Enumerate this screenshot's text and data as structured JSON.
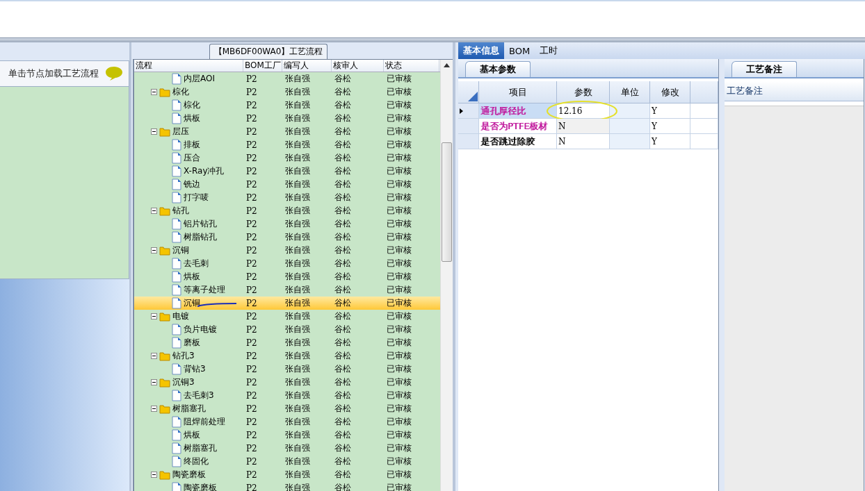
{
  "left_panel": {
    "hint": "单击节点加载工艺流程"
  },
  "flow_panel": {
    "title": "【MB6DF00WA0】工艺流程",
    "columns": [
      "流程",
      "BOM工厂",
      "编写人",
      "核审人",
      "状态"
    ],
    "items": [
      {
        "kind": "leaf",
        "label": "内层AOI",
        "bom": "P2",
        "author": "张自强",
        "reviewer": "谷松",
        "status": "已审核",
        "selected": false
      },
      {
        "kind": "group",
        "label": "棕化",
        "bom": "P2",
        "author": "张自强",
        "reviewer": "谷松",
        "status": "已审核",
        "selected": false,
        "expanded": true,
        "children": [
          {
            "kind": "leaf",
            "label": "棕化",
            "bom": "P2",
            "author": "张自强",
            "reviewer": "谷松",
            "status": "已审核",
            "selected": false
          },
          {
            "kind": "leaf",
            "label": "烘板",
            "bom": "P2",
            "author": "张自强",
            "reviewer": "谷松",
            "status": "已审核",
            "selected": false
          }
        ]
      },
      {
        "kind": "group",
        "label": "层压",
        "bom": "P2",
        "author": "张自强",
        "reviewer": "谷松",
        "status": "已审核",
        "selected": false,
        "expanded": true,
        "children": [
          {
            "kind": "leaf",
            "label": "排板",
            "bom": "P2",
            "author": "张自强",
            "reviewer": "谷松",
            "status": "已审核",
            "selected": false
          },
          {
            "kind": "leaf",
            "label": "压合",
            "bom": "P2",
            "author": "张自强",
            "reviewer": "谷松",
            "status": "已审核",
            "selected": false
          },
          {
            "kind": "leaf",
            "label": "X-Ray冲孔",
            "bom": "P2",
            "author": "张自强",
            "reviewer": "谷松",
            "status": "已审核",
            "selected": false
          },
          {
            "kind": "leaf",
            "label": "铣边",
            "bom": "P2",
            "author": "张自强",
            "reviewer": "谷松",
            "status": "已审核",
            "selected": false
          },
          {
            "kind": "leaf",
            "label": "打字唛",
            "bom": "P2",
            "author": "张自强",
            "reviewer": "谷松",
            "status": "已审核",
            "selected": false
          }
        ]
      },
      {
        "kind": "group",
        "label": "钻孔",
        "bom": "P2",
        "author": "张自强",
        "reviewer": "谷松",
        "status": "已审核",
        "selected": false,
        "expanded": true,
        "children": [
          {
            "kind": "leaf",
            "label": "铝片钻孔",
            "bom": "P2",
            "author": "张自强",
            "reviewer": "谷松",
            "status": "已审核",
            "selected": false
          },
          {
            "kind": "leaf",
            "label": "树脂钻孔",
            "bom": "P2",
            "author": "张自强",
            "reviewer": "谷松",
            "status": "已审核",
            "selected": false
          }
        ]
      },
      {
        "kind": "group",
        "label": "沉铜",
        "bom": "P2",
        "author": "张自强",
        "reviewer": "谷松",
        "status": "已审核",
        "selected": false,
        "expanded": true,
        "children": [
          {
            "kind": "leaf",
            "label": "去毛刺",
            "bom": "P2",
            "author": "张自强",
            "reviewer": "谷松",
            "status": "已审核",
            "selected": false
          },
          {
            "kind": "leaf",
            "label": "烘板",
            "bom": "P2",
            "author": "张自强",
            "reviewer": "谷松",
            "status": "已审核",
            "selected": false
          },
          {
            "kind": "leaf",
            "label": "等离子处理",
            "bom": "P2",
            "author": "张自强",
            "reviewer": "谷松",
            "status": "已审核",
            "selected": false
          },
          {
            "kind": "leaf",
            "label": "沉铜",
            "bom": "P2",
            "author": "张自强",
            "reviewer": "谷松",
            "status": "已审核",
            "selected": true
          }
        ]
      },
      {
        "kind": "group",
        "label": "电镀",
        "bom": "P2",
        "author": "张自强",
        "reviewer": "谷松",
        "status": "已审核",
        "selected": false,
        "expanded": true,
        "children": [
          {
            "kind": "leaf",
            "label": "负片电镀",
            "bom": "P2",
            "author": "张自强",
            "reviewer": "谷松",
            "status": "已审核",
            "selected": false
          },
          {
            "kind": "leaf",
            "label": "磨板",
            "bom": "P2",
            "author": "张自强",
            "reviewer": "谷松",
            "status": "已审核",
            "selected": false
          }
        ]
      },
      {
        "kind": "group",
        "label": "钻孔3",
        "bom": "P2",
        "author": "张自强",
        "reviewer": "谷松",
        "status": "已审核",
        "selected": false,
        "expanded": true,
        "children": [
          {
            "kind": "leaf",
            "label": "背钻3",
            "bom": "P2",
            "author": "张自强",
            "reviewer": "谷松",
            "status": "已审核",
            "selected": false
          }
        ]
      },
      {
        "kind": "group",
        "label": "沉铜3",
        "bom": "P2",
        "author": "张自强",
        "reviewer": "谷松",
        "status": "已审核",
        "selected": false,
        "expanded": true,
        "children": [
          {
            "kind": "leaf",
            "label": "去毛刺3",
            "bom": "P2",
            "author": "张自强",
            "reviewer": "谷松",
            "status": "已审核",
            "selected": false
          }
        ]
      },
      {
        "kind": "group",
        "label": "树脂塞孔",
        "bom": "P2",
        "author": "张自强",
        "reviewer": "谷松",
        "status": "已审核",
        "selected": false,
        "expanded": true,
        "children": [
          {
            "kind": "leaf",
            "label": "阻焊前处理",
            "bom": "P2",
            "author": "张自强",
            "reviewer": "谷松",
            "status": "已审核",
            "selected": false
          },
          {
            "kind": "leaf",
            "label": "烘板",
            "bom": "P2",
            "author": "张自强",
            "reviewer": "谷松",
            "status": "已审核",
            "selected": false
          },
          {
            "kind": "leaf",
            "label": "树脂塞孔",
            "bom": "P2",
            "author": "张自强",
            "reviewer": "谷松",
            "status": "已审核",
            "selected": false
          },
          {
            "kind": "leaf",
            "label": "终固化",
            "bom": "P2",
            "author": "张自强",
            "reviewer": "谷松",
            "status": "已审核",
            "selected": false
          }
        ]
      },
      {
        "kind": "group",
        "label": "陶瓷磨板",
        "bom": "P2",
        "author": "张自强",
        "reviewer": "谷松",
        "status": "已审核",
        "selected": false,
        "expanded": true,
        "children": [
          {
            "kind": "leaf",
            "label": "陶瓷磨板",
            "bom": "P2",
            "author": "张自强",
            "reviewer": "谷松",
            "status": "已审核",
            "selected": false
          }
        ]
      }
    ]
  },
  "detail_tabs": [
    {
      "label": "基本信息",
      "selected": true
    },
    {
      "label": "BOM",
      "selected": false
    },
    {
      "label": "工时",
      "selected": false
    }
  ],
  "params_panel": {
    "tab": "基本参数",
    "columns": [
      "项目",
      "参数",
      "单位",
      "修改"
    ],
    "rows": [
      {
        "item": "通孔厚径比",
        "value": "12.16",
        "unit": "",
        "edit": "Y",
        "color": "#c0179c",
        "selected": true
      },
      {
        "item": "是否为PTFE板材",
        "value": "N",
        "unit": "",
        "edit": "Y",
        "color": "#c0179c",
        "selected": false
      },
      {
        "item": "是否跳过除胶",
        "value": "N",
        "unit": "",
        "edit": "Y",
        "color": "#000000",
        "selected": false
      }
    ]
  },
  "notes_panel": {
    "tab": "工艺备注",
    "header": "工艺备注"
  }
}
